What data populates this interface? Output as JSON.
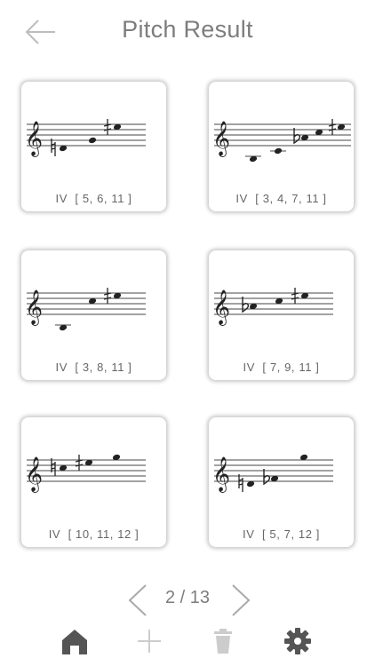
{
  "header": {
    "title": "Pitch Result",
    "back_icon": "arrow-left-icon"
  },
  "results": [
    {
      "label": "IV  [ 5, 6, 11 ]"
    },
    {
      "label": "IV  [ 3, 4, 7, 11 ]"
    },
    {
      "label": "IV  [ 3, 8, 11 ]"
    },
    {
      "label": "IV  [ 7, 9, 11 ]"
    },
    {
      "label": "IV  [ 10, 11, 12 ]"
    },
    {
      "label": "IV  [ 5, 7, 12 ]"
    }
  ],
  "pager": {
    "current": 2,
    "total": 13,
    "text": "2 / 13"
  },
  "toolbar": {
    "home_icon": "home-icon",
    "add_icon": "plus-icon",
    "delete_icon": "trash-icon",
    "settings_icon": "gear-icon"
  },
  "colors": {
    "title": "#7d7d7d",
    "icon_active": "#555555",
    "icon_disabled": "#cccccc"
  }
}
